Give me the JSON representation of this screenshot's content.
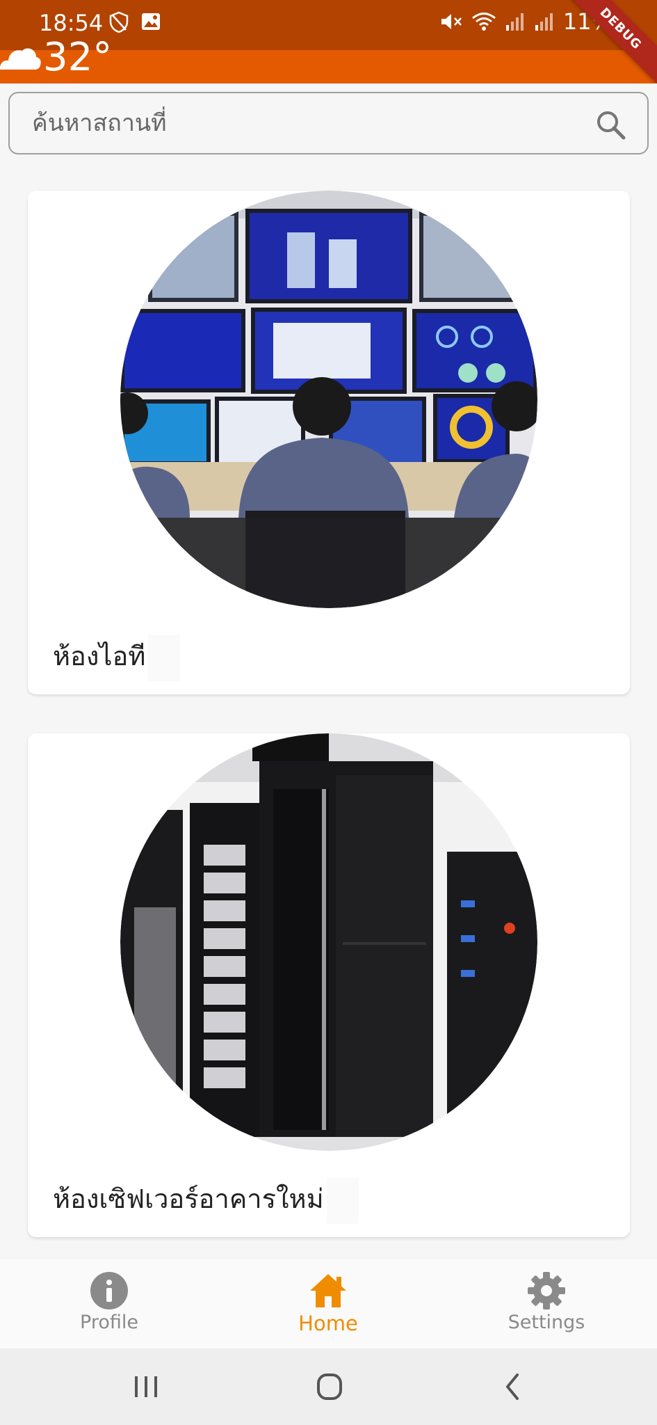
{
  "status_bar": {
    "time": "18:54",
    "battery": "11%",
    "icons": [
      "shield-icon",
      "gallery-icon",
      "mute-icon",
      "wifi-icon",
      "signal-icon",
      "signal-icon"
    ],
    "debug_label": "DEBUG"
  },
  "weather": {
    "temperature": "32°",
    "icon": "cloud-icon"
  },
  "search": {
    "placeholder": "ค้นหาสถานที่",
    "icon": "search-icon"
  },
  "cards": [
    {
      "title": "ห้องไอที",
      "image": "it-room-photo"
    },
    {
      "title": "ห้องเซิฟเวอร์อาคารใหม่",
      "image": "server-room-photo"
    }
  ],
  "bottom_nav": {
    "items": [
      {
        "label": "Profile",
        "icon": "info-icon",
        "active": false
      },
      {
        "label": "Home",
        "icon": "home-icon",
        "active": true
      },
      {
        "label": "Settings",
        "icon": "gear-icon",
        "active": false
      }
    ]
  },
  "colors": {
    "status_bar": "#b34300",
    "app_bar": "#e45a00",
    "accent": "#f08c00",
    "inactive": "#8a8a8a"
  }
}
